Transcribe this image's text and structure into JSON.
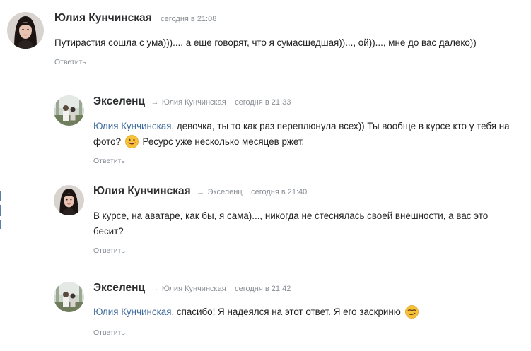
{
  "colors": {
    "link": "#3f6c9e",
    "meta": "#8a8f95",
    "text": "#222222",
    "author": "#2c2d2e"
  },
  "comments": [
    {
      "author": "Юлия Кунчинская",
      "date": "сегодня в 21:08",
      "text": "Путирастия сошла с ума)))..., а еще говорят, что я сумасшедшая))..., ой))..., мне до вас далеко))",
      "reply_label": "Ответить",
      "avatar_icon": "woman-portrait-avatar"
    },
    {
      "author": "Экселенц",
      "arrow": "→",
      "reply_to": "Юлия Кунчинская",
      "date": "сегодня в 21:33",
      "mention": "Юлия Кунчинская",
      "text_part1": ", девочка, ты то как раз переплюнула всех)) Ты вообще в курсе кто у тебя на фото?",
      "emoji": "grinning-face-emoji",
      "text_part2": " Ресурс уже несколько месяцев ржет.",
      "reply_label": "Ответить",
      "avatar_icon": "outdoor-photo-avatar"
    },
    {
      "author": "Юлия Кунчинская",
      "arrow": "→",
      "reply_to": "Экселенц",
      "date": "сегодня в 21:40",
      "text": "В курсе, на аватаре, как бы, я сама)..., никогда не стеснялась своей внешности, а вас это бесит?",
      "reply_label": "Ответить",
      "avatar_icon": "woman-portrait-avatar"
    },
    {
      "author": "Экселенц",
      "arrow": "→",
      "reply_to": "Юлия Кунчинская",
      "date": "сегодня в 21:42",
      "mention": "Юлия Кунчинская",
      "text_part1": ", спасибо! Я надеялся на этот ответ. Я его заскриню",
      "emoji": "smirking-face-emoji",
      "reply_label": "Ответить",
      "avatar_icon": "outdoor-photo-avatar"
    }
  ]
}
